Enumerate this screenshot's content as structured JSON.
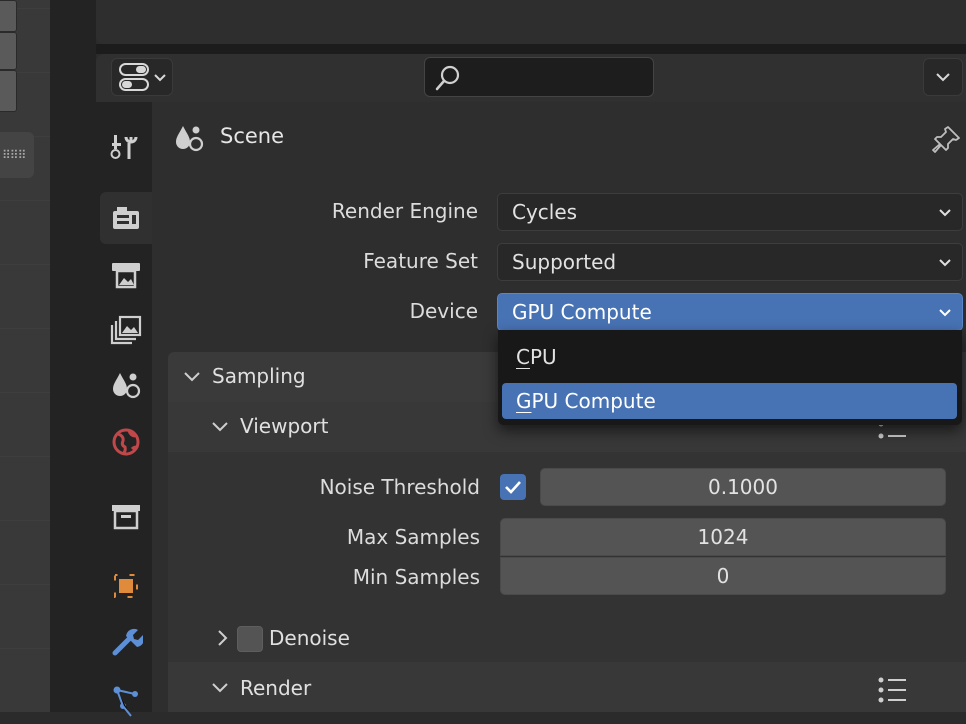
{
  "header": {
    "search": {
      "value": "",
      "placeholder": ""
    }
  },
  "scene": {
    "title": "Scene"
  },
  "render_settings": {
    "render_engine": {
      "label": "Render Engine",
      "value": "Cycles"
    },
    "feature_set": {
      "label": "Feature Set",
      "value": "Supported"
    },
    "device": {
      "label": "Device",
      "value": "GPU Compute"
    }
  },
  "device_menu": {
    "items": [
      {
        "first": "C",
        "rest": "PU",
        "selected": false
      },
      {
        "first": "G",
        "rest": "PU Compute",
        "selected": true
      }
    ]
  },
  "sampling": {
    "title": "Sampling",
    "viewport": {
      "title": "Viewport",
      "noise_threshold": {
        "label": "Noise Threshold",
        "enabled": true,
        "value": "0.1000"
      },
      "max_samples": {
        "label": "Max Samples",
        "value": "1024"
      },
      "min_samples": {
        "label": "Min Samples",
        "value": "0"
      },
      "denoise": {
        "label": "Denoise",
        "enabled": false
      }
    },
    "render": {
      "title": "Render"
    }
  },
  "tabs": [
    {
      "icon": "tool-icon",
      "active": false
    },
    {
      "icon": "render-properties-icon",
      "active": true
    },
    {
      "icon": "output-properties-icon",
      "active": false
    },
    {
      "icon": "view-layer-icon",
      "active": false
    },
    {
      "icon": "scene-icon",
      "active": false
    },
    {
      "icon": "world-icon",
      "active": false
    },
    {
      "icon": "collection-icon",
      "active": false
    },
    {
      "icon": "object-icon",
      "active": false
    },
    {
      "icon": "modifier-icon",
      "active": false
    },
    {
      "icon": "particles-icon",
      "active": false
    }
  ],
  "colors": {
    "accent": "#4772b3",
    "world_icon": "#c0484a",
    "object_icon": "#e08a3c",
    "modifier_icon": "#5d8fd6"
  }
}
